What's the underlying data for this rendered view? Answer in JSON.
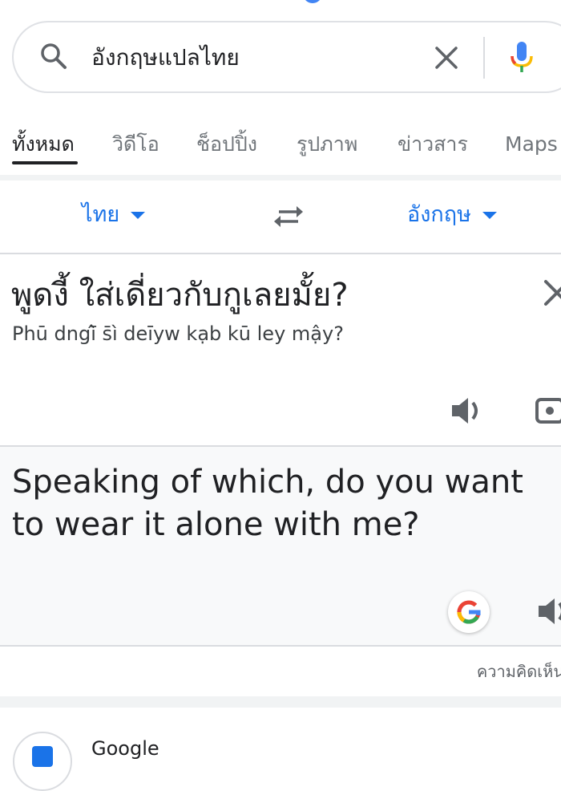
{
  "search": {
    "query": "อังกฤษแปลไทย"
  },
  "tabs": [
    {
      "label": "ทั้งหมด",
      "active": true
    },
    {
      "label": "วิดีโอ",
      "active": false
    },
    {
      "label": "ช็อปปิ้ง",
      "active": false
    },
    {
      "label": "รูปภาพ",
      "active": false
    },
    {
      "label": "ข่าวสาร",
      "active": false
    },
    {
      "label": "Maps",
      "active": false
    }
  ],
  "translator": {
    "source_language": "ไทย",
    "target_language": "อังกฤษ",
    "source_text": "พูดงี้ ใส่เดี่ยวกับกูเลยมั้ย?",
    "transliteration": "Phū dngī̂ s̄ì deīyw kạb kū ley mậy?",
    "translation": "Speaking of which, do you want to wear it alone with me?",
    "feedback_label": "ความคิดเห็น"
  },
  "next_result": {
    "title": "Google"
  },
  "colors": {
    "accent": "#1a73e8",
    "text": "#202124",
    "muted": "#70757a",
    "panel": "#f8f9fa"
  },
  "icons": [
    "search-icon",
    "clear-icon",
    "mic-icon",
    "swap-icon",
    "close-icon",
    "speaker-icon",
    "camera-icon",
    "google-g-icon"
  ]
}
